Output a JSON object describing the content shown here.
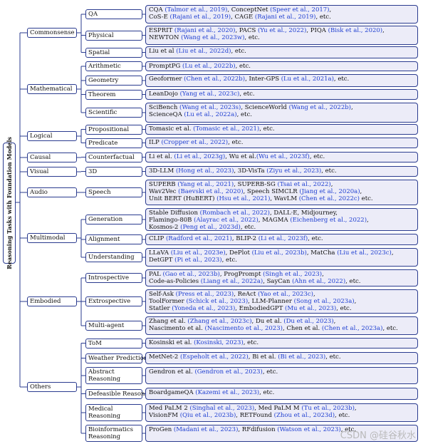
{
  "root": "Reasoning Tasks with Foundation Models",
  "categories": [
    {
      "label": "Commonsense"
    },
    {
      "label": "Mathematical"
    },
    {
      "label": "Logical"
    },
    {
      "label": "Causal"
    },
    {
      "label": "Visual"
    },
    {
      "label": "Audio"
    },
    {
      "label": "Multimodal"
    },
    {
      "label": "Embodied"
    },
    {
      "label": "Others"
    }
  ],
  "subs": [
    {
      "label": "QA"
    },
    {
      "label": "Physical"
    },
    {
      "label": "Spatial"
    },
    {
      "label": "Arithmetic"
    },
    {
      "label": "Geometry"
    },
    {
      "label": "Theorem"
    },
    {
      "label": "Scientific"
    },
    {
      "label": "Propositional"
    },
    {
      "label": "Predicate"
    },
    {
      "label": "Counterfactual"
    },
    {
      "label": "3D"
    },
    {
      "label": "Speech"
    },
    {
      "label": "Generation"
    },
    {
      "label": "Alignment"
    },
    {
      "label": "Understanding"
    },
    {
      "label": "Introspective"
    },
    {
      "label": "Extrospective"
    },
    {
      "label": "Multi-agent"
    },
    {
      "label": "ToM"
    },
    {
      "label": "Weather Prediction"
    },
    {
      "label": "Abstract Reasoning"
    },
    {
      "label": "Defeasible Reasoning"
    },
    {
      "label": "Medical Reasoning"
    },
    {
      "label": "Bioinformatics Reasoning"
    }
  ],
  "leaves": [
    {
      "lines": [
        [
          [
            "CQA ",
            0
          ],
          [
            "(Talmor et al., 2019)",
            1
          ],
          [
            ", ConceptNet ",
            0
          ],
          [
            "(Speer et al., 2017)",
            1
          ],
          [
            ",",
            0
          ]
        ],
        [
          [
            "CoS-E ",
            0
          ],
          [
            "(Rajani et al., 2019)",
            1
          ],
          [
            ", CAGE ",
            0
          ],
          [
            "(Rajani et al., 2019)",
            1
          ],
          [
            ", etc.",
            0
          ]
        ]
      ]
    },
    {
      "lines": [
        [
          [
            "ESPRIT ",
            0
          ],
          [
            "(Rajani et al., 2020)",
            1
          ],
          [
            ", PACS ",
            0
          ],
          [
            "(Yu et al., 2022)",
            1
          ],
          [
            ", PIQA ",
            0
          ],
          [
            "(Bisk et al., 2020)",
            1
          ],
          [
            ",",
            0
          ]
        ],
        [
          [
            "NEWTON ",
            0
          ],
          [
            "(Wang et al., 2023w)",
            1
          ],
          [
            ", etc.",
            0
          ]
        ]
      ]
    },
    {
      "lines": [
        [
          [
            "Liu et al ",
            0
          ],
          [
            "(Liu et al., 2022d)",
            1
          ],
          [
            ", etc.",
            0
          ]
        ]
      ]
    },
    {
      "lines": [
        [
          [
            "PromptPG ",
            0
          ],
          [
            "(Lu et al., 2022b)",
            1
          ],
          [
            ", etc.",
            0
          ]
        ]
      ]
    },
    {
      "lines": [
        [
          [
            "Geoformer ",
            0
          ],
          [
            "(Chen et al., 2022b)",
            1
          ],
          [
            ", Inter-GPS ",
            0
          ],
          [
            "(Lu et al., 2021a)",
            1
          ],
          [
            ", etc.",
            0
          ]
        ]
      ]
    },
    {
      "lines": [
        [
          [
            "LeanDojo ",
            0
          ],
          [
            "(Yang et al., 2023c)",
            1
          ],
          [
            ", etc.",
            0
          ]
        ]
      ]
    },
    {
      "lines": [
        [
          [
            "SciBench ",
            0
          ],
          [
            "(Wang et al., 2023s)",
            1
          ],
          [
            ", ScienceWorld ",
            0
          ],
          [
            "(Wang et al., 2022b)",
            1
          ],
          [
            ",",
            0
          ]
        ],
        [
          [
            "ScienceQA ",
            0
          ],
          [
            "(Lu et al., 2022a)",
            1
          ],
          [
            ", etc.",
            0
          ]
        ]
      ]
    },
    {
      "lines": [
        [
          [
            "Tomasic et al. ",
            0
          ],
          [
            "(Tomasic et al., 2021)",
            1
          ],
          [
            ", etc.",
            0
          ]
        ]
      ]
    },
    {
      "lines": [
        [
          [
            "ILP ",
            0
          ],
          [
            "(Cropper et al., 2022)",
            1
          ],
          [
            ", etc.",
            0
          ]
        ]
      ]
    },
    {
      "lines": [
        [
          [
            "Li et al. ",
            0
          ],
          [
            "(Li et al., 2023g)",
            1
          ],
          [
            ", Wu et al.",
            0
          ],
          [
            "(Wu et al., 2023f)",
            1
          ],
          [
            ", etc.",
            0
          ]
        ]
      ]
    },
    {
      "lines": [
        [
          [
            "3D-LLM ",
            0
          ],
          [
            "(Hong et al., 2023)",
            1
          ],
          [
            ", 3D-VisTa ",
            0
          ],
          [
            "(Ziyu et al., 2023)",
            1
          ],
          [
            ", etc.",
            0
          ]
        ]
      ]
    },
    {
      "lines": [
        [
          [
            "SUPERB ",
            0
          ],
          [
            "(Yang et al., 2021)",
            1
          ],
          [
            ", SUPERB-SG ",
            0
          ],
          [
            "(Tsai et al., 2022)",
            1
          ],
          [
            ",",
            0
          ]
        ],
        [
          [
            "Wav2Vec ",
            0
          ],
          [
            "(Baevski et al., 2020)",
            1
          ],
          [
            ", Speech SIMCLR ",
            0
          ],
          [
            "(Jiang et al., 2020a)",
            1
          ],
          [
            ",",
            0
          ]
        ],
        [
          [
            "Unit BERT (HuBERT) ",
            0
          ],
          [
            "(Hsu et al., 2021)",
            1
          ],
          [
            ", WavLM ",
            0
          ],
          [
            "(Chen et al., 2022c)",
            1
          ],
          [
            " etc.",
            0
          ]
        ]
      ]
    },
    {
      "lines": [
        [
          [
            "Stable Diffusion ",
            0
          ],
          [
            "(Rombach et al., 2022)",
            1
          ],
          [
            ", DALL·E, Midjourney,",
            0
          ]
        ],
        [
          [
            "Flamingo-80B ",
            0
          ],
          [
            "(Alayrac et al., 2022)",
            1
          ],
          [
            ", MAGMA ",
            0
          ],
          [
            "(Eichenberg et al., 2022)",
            1
          ],
          [
            ",",
            0
          ]
        ],
        [
          [
            "Kosmos-2 ",
            0
          ],
          [
            "(Peng et al., 2023d)",
            1
          ],
          [
            ", etc.",
            0
          ]
        ]
      ]
    },
    {
      "lines": [
        [
          [
            "CLIP ",
            0
          ],
          [
            "(Radford et al., 2021)",
            1
          ],
          [
            ", BLIP-2 ",
            0
          ],
          [
            "(Li et al., 2023f)",
            1
          ],
          [
            ", etc.",
            0
          ]
        ]
      ]
    },
    {
      "lines": [
        [
          [
            "LLaVA ",
            0
          ],
          [
            "(Liu et al., 2023e)",
            1
          ],
          [
            ", DePlot ",
            0
          ],
          [
            "(Liu et al., 2023b)",
            1
          ],
          [
            ", MatCha ",
            0
          ],
          [
            "(Liu et al., 2023c)",
            1
          ],
          [
            ",",
            0
          ]
        ],
        [
          [
            "DetGPT ",
            0
          ],
          [
            "(Pi et al., 2023)",
            1
          ],
          [
            ", etc.",
            0
          ]
        ]
      ]
    },
    {
      "lines": [
        [
          [
            "PAL ",
            0
          ],
          [
            "(Gao et al., 2023b)",
            1
          ],
          [
            ", ProgPrompt ",
            0
          ],
          [
            "(Singh et al., 2023)",
            1
          ],
          [
            ",",
            0
          ]
        ],
        [
          [
            "Code-as-Policies ",
            0
          ],
          [
            "(Liang et al., 2022a)",
            1
          ],
          [
            ", SayCan ",
            0
          ],
          [
            "(Ahn et al., 2022)",
            1
          ],
          [
            ", etc.",
            0
          ]
        ]
      ]
    },
    {
      "lines": [
        [
          [
            "Self-Ask ",
            0
          ],
          [
            "(Press et al., 2023)",
            1
          ],
          [
            ", ReAct ",
            0
          ],
          [
            "(Yao et al., 2023c)",
            1
          ],
          [
            ",",
            0
          ]
        ],
        [
          [
            "ToolFormer ",
            0
          ],
          [
            "(Schick et al., 2023)",
            1
          ],
          [
            ", LLM-Planner ",
            0
          ],
          [
            "(Song et al., 2023a)",
            1
          ],
          [
            ",",
            0
          ]
        ],
        [
          [
            "Statler ",
            0
          ],
          [
            "(Yoneda et al., 2023)",
            1
          ],
          [
            ", EmbodiedGPT ",
            0
          ],
          [
            "(Mu et al., 2023)",
            1
          ],
          [
            ", etc.",
            0
          ]
        ]
      ]
    },
    {
      "lines": [
        [
          [
            "Zhang et al. ",
            0
          ],
          [
            "(Zhang et al., 2023c)",
            1
          ],
          [
            ", Du et al. ",
            0
          ],
          [
            "(Du et al., 2023)",
            1
          ],
          [
            ",",
            0
          ]
        ],
        [
          [
            "Nascimento et al. ",
            0
          ],
          [
            "(Nascimento et al., 2023)",
            1
          ],
          [
            ", Chen et al. ",
            0
          ],
          [
            "(Chen et al., 2023a)",
            1
          ],
          [
            ", etc.",
            0
          ]
        ]
      ]
    },
    {
      "lines": [
        [
          [
            "Kosinski et al. ",
            0
          ],
          [
            "(Kosinski, 2023)",
            1
          ],
          [
            ", etc.",
            0
          ]
        ]
      ]
    },
    {
      "lines": [
        [
          [
            "MetNet-2 ",
            0
          ],
          [
            "(Espeholt et al., 2022)",
            1
          ],
          [
            ", Bi et al. ",
            0
          ],
          [
            "(Bi et al., 2023)",
            1
          ],
          [
            ", etc.",
            0
          ]
        ]
      ]
    },
    {
      "lines": [
        [
          [
            "Gendron et al. ",
            0
          ],
          [
            "(Gendron et al., 2023)",
            1
          ],
          [
            ", etc.",
            0
          ]
        ]
      ]
    },
    {
      "lines": [
        [
          [
            "BoardgameQA ",
            0
          ],
          [
            "(Kazemi et al., 2023)",
            1
          ],
          [
            ", etc.",
            0
          ]
        ]
      ]
    },
    {
      "lines": [
        [
          [
            "Med PaLM 2 ",
            0
          ],
          [
            "(Singhal et al., 2023)",
            1
          ],
          [
            ", Med PaLM M ",
            0
          ],
          [
            "(Tu et al., 2023b)",
            1
          ],
          [
            ",",
            0
          ]
        ],
        [
          [
            "VisionFM ",
            0
          ],
          [
            "(Qiu et al., 2023b)",
            1
          ],
          [
            ", RETFound ",
            0
          ],
          [
            "(Zhou et al., 2023d)",
            1
          ],
          [
            ", etc.",
            0
          ]
        ]
      ]
    },
    {
      "lines": [
        [
          [
            "ProGen ",
            0
          ],
          [
            "(Madani et al., 2023)",
            1
          ],
          [
            ", RFdifusion ",
            0
          ],
          [
            "(Watson et al., 2023)",
            1
          ],
          [
            ", etc.",
            0
          ]
        ]
      ]
    }
  ],
  "watermark": "CSDN @硅谷秋水"
}
